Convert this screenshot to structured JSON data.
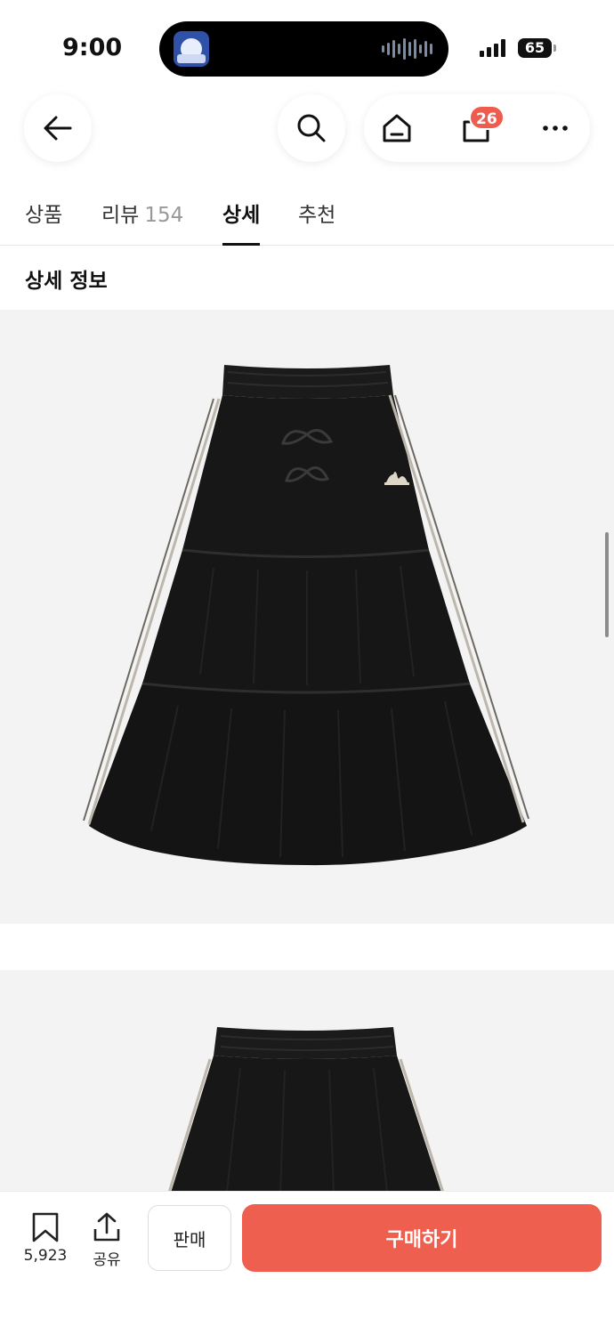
{
  "status_bar": {
    "time": "9:00",
    "battery": "65"
  },
  "header": {
    "back_icon": "arrow-left-icon",
    "search_icon": "search-icon",
    "home_icon": "home-icon",
    "cart_icon": "shopping-bag-icon",
    "cart_badge": "26",
    "more_icon": "more-horizontal-icon"
  },
  "tabs": [
    {
      "label": "상품",
      "count": ""
    },
    {
      "label": "리뷰",
      "count": "154"
    },
    {
      "label": "상세",
      "count": ""
    },
    {
      "label": "추천",
      "count": ""
    }
  ],
  "active_tab": "상세",
  "section": {
    "title": "상세 정보"
  },
  "images": [
    {
      "description_icon": "skirt-front-image"
    },
    {
      "description_icon": "skirt-back-image"
    }
  ],
  "bottom_bar": {
    "bookmark_icon": "bookmark-icon",
    "bookmark_count": "5,923",
    "share_icon": "share-icon",
    "share_label": "공유",
    "sell_label": "판매",
    "buy_label": "구매하기"
  },
  "colors": {
    "accent": "#ef5f4f",
    "badge": "#ef5b4c",
    "image_bg": "#f3f3f3"
  }
}
